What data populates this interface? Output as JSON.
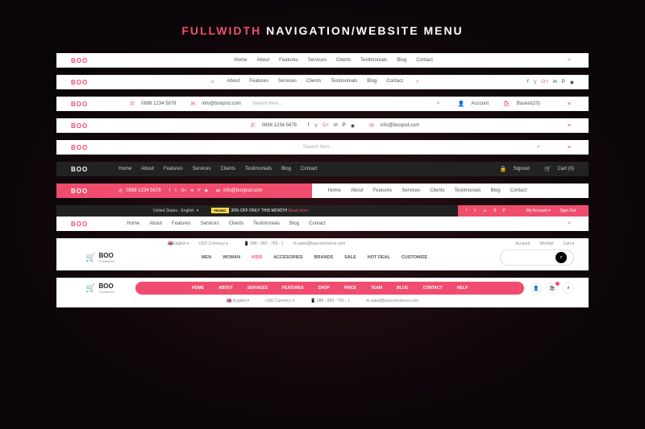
{
  "title": {
    "pink": "FULLWIDTH",
    "white": "NAVIGATION/WEBSITE MENU"
  },
  "logo": "BOO",
  "logo_commerce": {
    "main": "BOO",
    "sub": "Commerce"
  },
  "nav_main": [
    "Home",
    "About",
    "Features",
    "Services",
    "Clients",
    "Testimonials",
    "Blog",
    "Contact"
  ],
  "nav_shop": [
    "MEN",
    "WOMAN",
    "KIDS",
    "ACCESORIES",
    "BRANDS",
    "SALE",
    "HOT DEAL",
    "CUSTOMIZE"
  ],
  "nav_pill": [
    "HOME",
    "ABOUT",
    "SERVICES",
    "FEATURES",
    "SHOP",
    "PRICE",
    "TEAM",
    "BLOG",
    "CONTACT",
    "HELP"
  ],
  "phone": "0898 1234 5678",
  "phone2": "088 - 999 - 765 - 1",
  "email": "info@boopsd.com",
  "email2": "sales@boocommerce.com",
  "email3": "info@boopsd.com",
  "search_ph": "Search here...",
  "account": "Account",
  "basket": "Basket(20)",
  "signout": "Signout",
  "cart": "Cart (0)",
  "topbar": {
    "region": "United States - English",
    "promo_tag": "PROMO",
    "promo_text": "30% OFF ONLY THIS MONTH!",
    "promo_link": "Read more.",
    "myaccount": "My Account",
    "signout": "Sign Out"
  },
  "lang": "English",
  "currency": "USD Currency",
  "wishlist": "Wishlist",
  "acct": "Account"
}
